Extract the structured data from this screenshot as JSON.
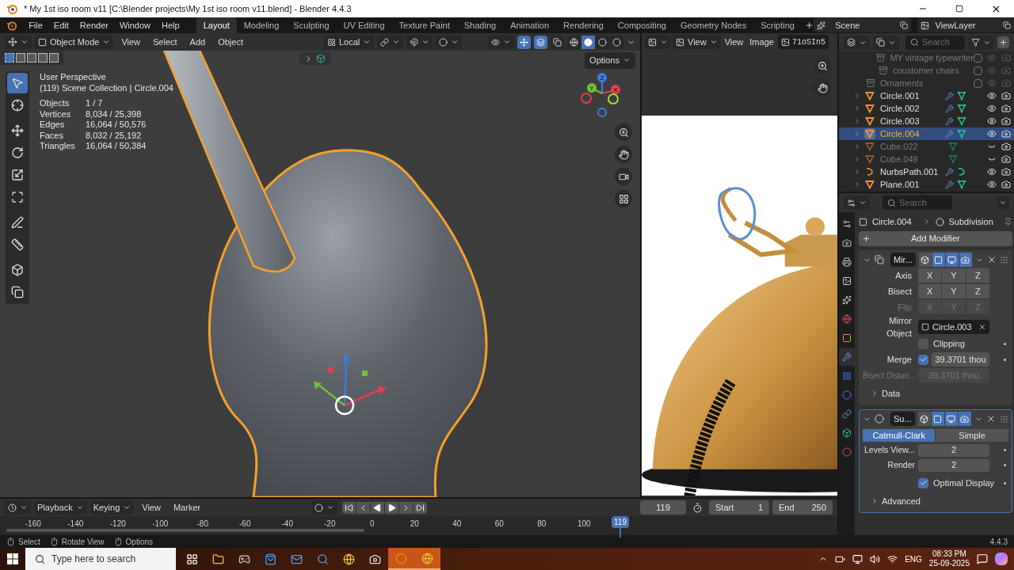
{
  "window": {
    "title": "* My 1st iso room v11 [C:\\Blender projects\\My 1st iso room v11.blend] - Blender 4.4.3"
  },
  "menus": [
    "File",
    "Edit",
    "Render",
    "Window",
    "Help"
  ],
  "workspaces": [
    {
      "label": "Layout",
      "selected": true
    },
    {
      "label": "Modeling",
      "selected": false
    },
    {
      "label": "Sculpting",
      "selected": false
    },
    {
      "label": "UV Editing",
      "selected": false
    },
    {
      "label": "Texture Paint",
      "selected": false
    },
    {
      "label": "Shading",
      "selected": false
    },
    {
      "label": "Animation",
      "selected": false
    },
    {
      "label": "Rendering",
      "selected": false
    },
    {
      "label": "Compositing",
      "selected": false
    },
    {
      "label": "Geometry Nodes",
      "selected": false
    },
    {
      "label": "Scripting",
      "selected": false
    }
  ],
  "scene": "Scene",
  "view_layer": "ViewLayer",
  "viewport": {
    "mode": "Object Mode",
    "menus": [
      "View",
      "Select",
      "Add",
      "Object"
    ],
    "orientation": "Local",
    "options": "Options",
    "tools": [
      {
        "kind": "select",
        "selected": true
      },
      {
        "kind": "cursor",
        "selected": false
      },
      {
        "kind": "move",
        "selected": false
      },
      {
        "kind": "rotate",
        "selected": false
      },
      {
        "kind": "scale",
        "selected": false
      },
      {
        "kind": "transform",
        "selected": false
      },
      {
        "kind": "annotate",
        "selected": false
      },
      {
        "kind": "measure",
        "selected": false
      },
      {
        "kind": "add-cube",
        "selected": false
      },
      {
        "kind": "extrude",
        "selected": false
      }
    ],
    "info": [
      "User Perspective",
      "(119) Scene Collection | Circle.004"
    ],
    "stats": [
      {
        "label": "Objects",
        "value": "1 / 7"
      },
      {
        "label": "Vertices",
        "value": "8,034 / 25,398"
      },
      {
        "label": "Edges",
        "value": "16,064 / 50,576"
      },
      {
        "label": "Faces",
        "value": "8,032 / 25,192"
      },
      {
        "label": "Triangles",
        "value": "16,064 / 50,384"
      }
    ],
    "gizmo_labels": [
      "X",
      "Y",
      "Z"
    ]
  },
  "image_editor": {
    "mode": "View",
    "menus": [
      "View",
      "Image"
    ],
    "image_name": "71oSIn5"
  },
  "outliner": {
    "search_placeholder": "Search",
    "continued_children": [
      {
        "name": "MY vintage typewriter",
        "kind": "collection",
        "included": false
      },
      {
        "name": "coustomer chairs",
        "kind": "collection",
        "included": false
      }
    ],
    "items": [
      {
        "name": "Ornaments",
        "kind": "collection",
        "included": false
      },
      {
        "name": "Circle.001",
        "kind": "mesh",
        "selected": false,
        "active": false,
        "visible": true,
        "modifiers": true
      },
      {
        "name": "Circle.002",
        "kind": "mesh",
        "selected": false,
        "active": false,
        "visible": true,
        "modifiers": true
      },
      {
        "name": "Circle.003",
        "kind": "mesh",
        "selected": false,
        "active": false,
        "visible": true,
        "modifiers": true
      },
      {
        "name": "Circle.004",
        "kind": "mesh",
        "selected": true,
        "active": true,
        "visible": true,
        "modifiers": true
      },
      {
        "name": "Cube.022",
        "kind": "mesh",
        "selected": false,
        "active": false,
        "visible": false,
        "modifiers": false
      },
      {
        "name": "Cube.049",
        "kind": "mesh",
        "selected": false,
        "active": false,
        "visible": false,
        "modifiers": false
      },
      {
        "name": "NurbsPath.001",
        "kind": "curve",
        "selected": false,
        "active": false,
        "visible": true,
        "modifiers": true
      },
      {
        "name": "Plane.001",
        "kind": "mesh",
        "selected": false,
        "active": false,
        "visible": true,
        "modifiers": true
      }
    ]
  },
  "properties": {
    "search_placeholder": "Search",
    "tabs": [
      {
        "kind": "tool",
        "selected": false
      },
      {
        "kind": "render",
        "selected": false
      },
      {
        "kind": "output",
        "selected": false
      },
      {
        "kind": "view-layer",
        "selected": false
      },
      {
        "kind": "scene",
        "selected": false
      },
      {
        "kind": "world",
        "selected": false
      },
      {
        "kind": "object",
        "selected": false
      },
      {
        "kind": "modifiers",
        "selected": true
      },
      {
        "kind": "particles",
        "selected": false
      },
      {
        "kind": "physics",
        "selected": false
      },
      {
        "kind": "constraints",
        "selected": false
      },
      {
        "kind": "data",
        "selected": false
      },
      {
        "kind": "material",
        "selected": false
      }
    ],
    "breadcrumb": [
      "Circle.004",
      "Subdivision"
    ],
    "add_modifier": "Add Modifier",
    "modifiers": [
      {
        "kind": "mirror",
        "name": "Mir...",
        "active": false,
        "expanded": true,
        "toggles": [
          {
            "kind": "on-cage",
            "on": false
          },
          {
            "kind": "edit-mode",
            "on": true
          },
          {
            "kind": "viewport",
            "on": true
          },
          {
            "kind": "render",
            "on": true
          }
        ],
        "axis_rows": [
          {
            "label": "Axis",
            "disabled": false,
            "buttons": [
              {
                "label": "X",
                "selected": false
              },
              {
                "label": "Y",
                "selected": false
              },
              {
                "label": "Z",
                "selected": false
              }
            ]
          },
          {
            "label": "Bisect",
            "disabled": false,
            "buttons": [
              {
                "label": "X",
                "selected": false
              },
              {
                "label": "Y",
                "selected": false
              },
              {
                "label": "Z",
                "selected": false
              }
            ]
          },
          {
            "label": "Flip",
            "disabled": true,
            "buttons": [
              {
                "label": "X",
                "selected": false
              },
              {
                "label": "Y",
                "selected": false
              },
              {
                "label": "Z",
                "selected": false
              }
            ]
          }
        ],
        "mirror_object": {
          "label": "Mirror Object",
          "value": "Circle.003"
        },
        "clipping": {
          "label": "Clipping",
          "checked": false
        },
        "merge": {
          "label": "Merge",
          "checked": true,
          "value": "39.3701 thou"
        },
        "bisect_distance": {
          "label": "Bisect Distan...",
          "value": "39.3701 thou",
          "disabled": true
        },
        "subpanel": {
          "label": "Data",
          "expanded": false
        }
      },
      {
        "kind": "subdivision",
        "name": "Su...",
        "active": true,
        "expanded": true,
        "toggles": [
          {
            "kind": "on-cage",
            "on": false
          },
          {
            "kind": "edit-mode",
            "on": true
          },
          {
            "kind": "viewport",
            "on": true
          },
          {
            "kind": "render",
            "on": true
          }
        ],
        "methods": [
          {
            "label": "Catmull-Clark",
            "selected": true
          },
          {
            "label": "Simple",
            "selected": false
          }
        ],
        "fields": [
          {
            "label": "Levels View...",
            "value": "2"
          },
          {
            "label": "Render",
            "value": "2"
          }
        ],
        "optimal_display": {
          "label": "Optimal Display",
          "checked": true
        },
        "subpanel": {
          "label": "Advanced",
          "expanded": false
        }
      }
    ]
  },
  "timeline": {
    "menus": [
      "Playback",
      "Keying"
    ],
    "plain_menus": [
      "View",
      "Marker"
    ],
    "current_frame": "119",
    "start": {
      "label": "Start",
      "value": "1"
    },
    "end": {
      "label": "End",
      "value": "250"
    },
    "ticks": [
      "-160",
      "-140",
      "-120",
      "-100",
      "-80",
      "-60",
      "-40",
      "-20",
      "0",
      "20",
      "40",
      "60",
      "80",
      "100"
    ],
    "playhead": "119"
  },
  "status_bar": {
    "hints": [
      "Select",
      "Rotate View",
      "Options"
    ],
    "version": "4.4.3"
  },
  "taskbar": {
    "search_placeholder": "Type here to search",
    "apps": [
      {
        "kind": "task-view",
        "selected": false
      },
      {
        "kind": "files",
        "selected": false
      },
      {
        "kind": "game",
        "selected": false
      },
      {
        "kind": "store",
        "selected": false
      },
      {
        "kind": "mail",
        "selected": false
      },
      {
        "kind": "search",
        "selected": false
      },
      {
        "kind": "browser",
        "selected": false
      },
      {
        "kind": "camera",
        "selected": false
      },
      {
        "kind": "blender",
        "selected": true
      },
      {
        "kind": "browser",
        "selected": true
      }
    ],
    "language": "ENG",
    "time": "08:33 PM",
    "date": "25-09-2025"
  }
}
